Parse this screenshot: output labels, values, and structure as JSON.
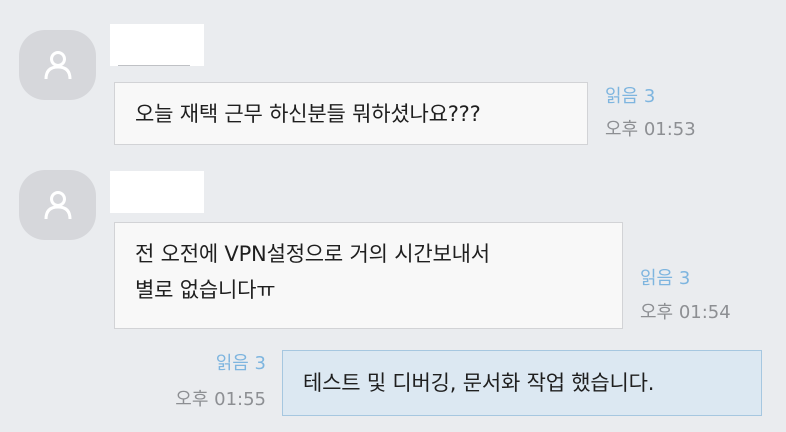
{
  "messages": [
    {
      "text": "오늘 재택 근무 하신분들 뭐하셨나요???",
      "read": "읽음 3",
      "time": "오후 01:53"
    },
    {
      "lines": [
        "전 오전에 VPN설정으로 거의 시간보내서",
        "별로 없습니다ㅠ"
      ],
      "read": "읽음 3",
      "time": "오후 01:54"
    },
    {
      "text": "테스트 및 디버깅, 문서화 작업 했습니다.",
      "read": "읽음 3",
      "time": "오후 01:55"
    }
  ],
  "icons": {
    "avatar": "person-icon"
  },
  "colors": {
    "background": "#eaecef",
    "bubble_other": "#f8f8f8",
    "bubble_mine": "#dce8f2",
    "read_count": "#7eb5df",
    "timestamp": "#8d8f93"
  }
}
